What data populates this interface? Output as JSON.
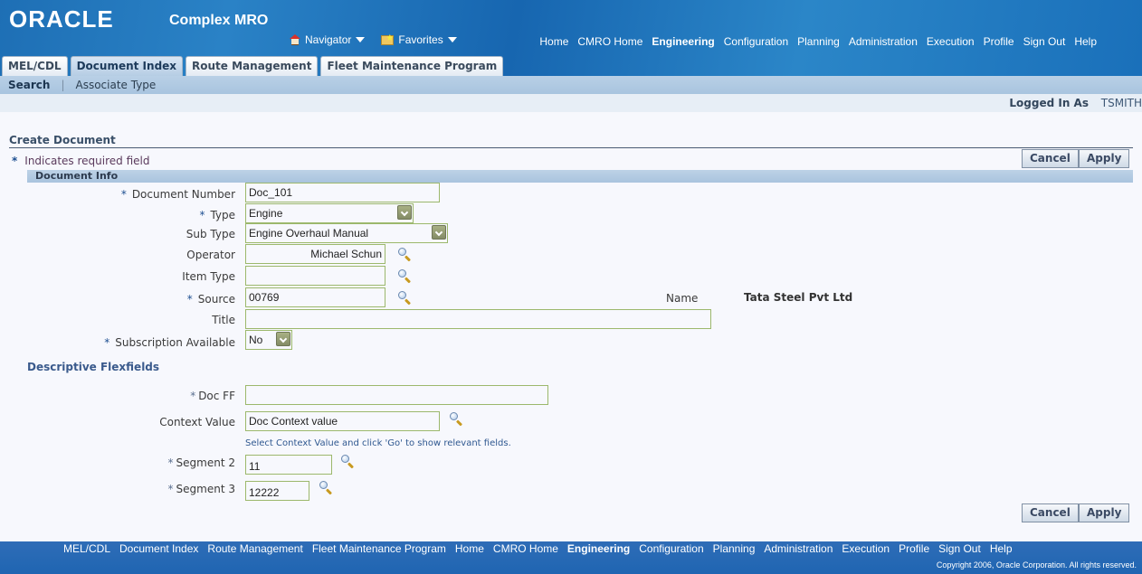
{
  "header": {
    "logo": "ORACLE",
    "app_title": "Complex MRO",
    "navigator_label": "Navigator",
    "favorites_label": "Favorites",
    "global_links": [
      {
        "label": "Home",
        "bold": false
      },
      {
        "label": "CMRO Home",
        "bold": false
      },
      {
        "label": "Engineering",
        "bold": true
      },
      {
        "label": "Configuration",
        "bold": false
      },
      {
        "label": "Planning",
        "bold": false
      },
      {
        "label": "Administration",
        "bold": false
      },
      {
        "label": "Execution",
        "bold": false
      },
      {
        "label": "Profile",
        "bold": false
      },
      {
        "label": "Sign Out",
        "bold": false
      },
      {
        "label": "Help",
        "bold": false
      }
    ]
  },
  "tabs": [
    {
      "label": "MEL/CDL",
      "active": false
    },
    {
      "label": "Document Index",
      "active": true
    },
    {
      "label": "Route Management",
      "active": false
    },
    {
      "label": "Fleet Maintenance Program",
      "active": false
    }
  ],
  "subtabs": [
    {
      "label": "Search",
      "active": true
    },
    {
      "label": "Associate Type",
      "active": false
    }
  ],
  "user": {
    "logged_in_label": "Logged In As",
    "username": "TSMITH"
  },
  "page": {
    "title": "Create Document",
    "required_note": "Indicates required field",
    "required_star": "*",
    "cancel_label": "Cancel",
    "apply_label": "Apply"
  },
  "document_info": {
    "section_title": "Document Info",
    "document_number": {
      "label": "Document Number",
      "required": true,
      "value": "Doc_101"
    },
    "type": {
      "label": "Type",
      "required": true,
      "value": "Engine"
    },
    "sub_type": {
      "label": "Sub Type",
      "required": false,
      "value": "Engine Overhaul Manual"
    },
    "operator": {
      "label": "Operator",
      "required": false,
      "value": "Michael Schun"
    },
    "item_type": {
      "label": "Item Type",
      "required": false,
      "value": ""
    },
    "source": {
      "label": "Source",
      "required": true,
      "value": "00769"
    },
    "source_name_label": "Name",
    "source_name_value": "Tata Steel Pvt Ltd",
    "title": {
      "label": "Title",
      "required": false,
      "value": ""
    },
    "subscription": {
      "label": "Subscription Available",
      "required": true,
      "value": "No"
    }
  },
  "flexfields": {
    "section_title": "Descriptive Flexfields",
    "doc_ff": {
      "label": "Doc FF",
      "required": true,
      "value": ""
    },
    "context_value": {
      "label": "Context Value",
      "value": "Doc Context value"
    },
    "hint": "Select Context Value and click 'Go' to show relevant fields.",
    "segment2": {
      "label": "Segment 2",
      "required": true,
      "value": "11"
    },
    "segment3": {
      "label": "Segment 3",
      "required": true,
      "value": "12222"
    }
  },
  "footer": {
    "links": [
      {
        "label": "MEL/CDL",
        "bold": false
      },
      {
        "label": "Document Index",
        "bold": false
      },
      {
        "label": "Route Management",
        "bold": false
      },
      {
        "label": "Fleet Maintenance Program",
        "bold": false
      },
      {
        "label": "Home",
        "bold": false
      },
      {
        "label": "CMRO Home",
        "bold": false
      },
      {
        "label": "Engineering",
        "bold": true
      },
      {
        "label": "Configuration",
        "bold": false
      },
      {
        "label": "Planning",
        "bold": false
      },
      {
        "label": "Administration",
        "bold": false
      },
      {
        "label": "Execution",
        "bold": false
      },
      {
        "label": "Profile",
        "bold": false
      },
      {
        "label": "Sign Out",
        "bold": false
      },
      {
        "label": "Help",
        "bold": false
      }
    ],
    "copyright": "Copyright 2006, Oracle Corporation. All rights reserved."
  }
}
